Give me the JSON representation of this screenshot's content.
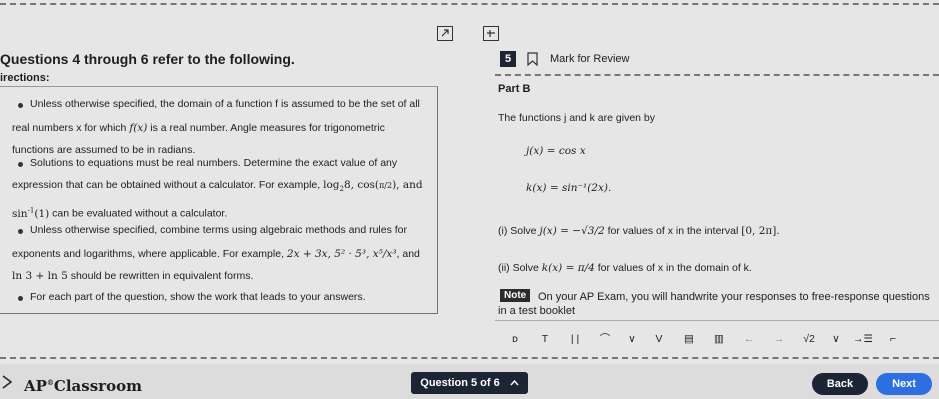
{
  "header": {
    "section_title": "Questions 4 through 6 refer to the following.",
    "question_number": "5",
    "mark_for_review": "Mark for Review"
  },
  "directions": {
    "title": "irections:",
    "b1_l1": "Unless otherwise specified, the domain of a function f is assumed to be the set of all",
    "b1_l2a": "real numbers x for which",
    "b1_fx": "f(x)",
    "b1_l2b": "is a real number. Angle measures for trigonometric",
    "b1_l3": "functions are assumed to be in radians.",
    "b2_l1": "Solutions to equations must be real numbers. Determine the exact value of any",
    "b2_l2a": "expression that can be obtained without a calculator. For example,",
    "b2_log": "log",
    "b2_log_sub": "2",
    "b2_log_arg": "8, cos(",
    "b2_pi_frac": "π/2",
    "b2_log_end": "), and",
    "b2_l3_sin": "sin",
    "b2_l3_sup": "-1",
    "b2_l3_arg": "(1)",
    "b2_l3_rest": "can be evaluated without a calculator.",
    "b3_l1": "Unless otherwise specified, combine terms using algebraic methods and rules for",
    "b3_l2a": "exponents and logarithms, where applicable. For example,",
    "b3_expr": "2x + 3x, 5² · 5³, x⁵/x³",
    "b3_l2b": ", and",
    "b3_l3_expr": "ln 3 + ln 5",
    "b3_l3_rest": "should be rewritten in equivalent forms.",
    "b4_l1": "For each part of the question, show the work that leads to your answers."
  },
  "question": {
    "part": "Part B",
    "intro": "The functions j and k are given by",
    "j_def": "j(x) = cos x",
    "k_def": "k(x) = sin⁻¹(2x).",
    "i_label": "(i) Solve",
    "i_eq": "j(x) = −√3/2",
    "i_rest": "for values of x in the interval",
    "i_interval": "[0, 2π].",
    "ii_label": "(ii) Solve",
    "ii_eq": "k(x) = π/4",
    "ii_rest": "for values of x in the domain of k.",
    "note_badge": "Note",
    "note_text": "On your AP Exam, you will handwrite your responses to free-response questions",
    "note_text2": "in a test booklet"
  },
  "toolbar": {
    "items": [
      "ᴅ",
      "T",
      "| |",
      "⌒",
      "∨",
      "V",
      "▤",
      "▥",
      "←",
      "→",
      "√2",
      "∨",
      "→☰",
      "⌐"
    ]
  },
  "footer": {
    "logo_text": "AP",
    "logo_sup": "®",
    "logo_text2": "Classroom",
    "question_nav": "Question 5 of 6",
    "back": "Back",
    "next": "Next"
  },
  "colors": {
    "nav_dark": "#1c2436",
    "next_blue": "#2d6fe0",
    "note_bg": "#2c2c2c"
  }
}
